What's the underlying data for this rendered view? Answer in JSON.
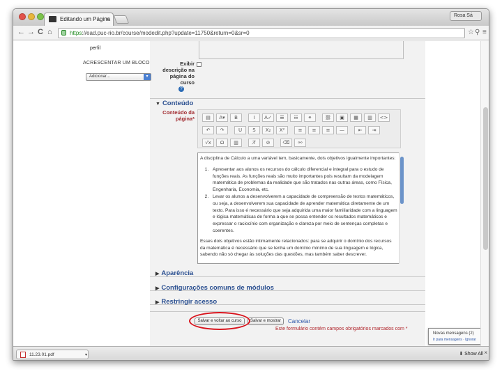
{
  "browser": {
    "tab_title": "Editando um Página",
    "tab_close": "×",
    "user_label": "Rosa Sá",
    "url_scheme": "https",
    "url_rest": "://ead.puc-rio.br/course/modedit.php?update=11750&return=0&sr=0",
    "back": "←",
    "forward": "→",
    "reload": "C",
    "home": "⌂",
    "star": "☆",
    "search": "⚲",
    "menu": "≡"
  },
  "sidebar": {
    "perfil": "perfil",
    "add_block_heading": "ACRESCENTAR UM BLOCO",
    "add_block_select": "Adicionar..."
  },
  "form": {
    "exibir_label": "Exibir descrição na página do curso",
    "help": "?",
    "section_conteudo": "Conteúdo",
    "conteudo_label": "Conteúdo da página*",
    "section_aparencia": "Aparência",
    "section_config": "Configurações comuns de módulos",
    "section_restringir": "Restringir acesso",
    "btn_save_return": "Salvar e voltar ao curso",
    "btn_save_show": "Salvar e mostrar",
    "cancel": "Cancelar",
    "required_note": "Este formulário contém campos obrigatórios marcados com *"
  },
  "editor": {
    "intro": "A disciplina de Cálculo a uma variável tem, basicamente, dois objetivos igualmente importantes:",
    "items": [
      "Apresentar aos alunos os recursos do cálculo diferencial e integral para o estudo de funções reais. As funções reais são muito importantes pois resultam da modelagem matemática de problemas da realidade que são tratados nas outras áreas, como Física, Engenharia, Economia, etc.",
      "Levar os alunos a desenvolverem a capacidade de compreensão de textos matemáticos, ou seja, a desenvolverem sua capacidade de aprender matemática diretamente de um texto. Para isso é necessário que seja adquirida uma maior familiaridade com a linguagem e lógica matemáticas de forma a que se possa entender os resultados matemáticos e expressar o raciocínio com organização e clareza por meio de sentenças completas e coerentes."
    ],
    "outro": "Esses dois objetivos estão intimamente relacionados: para se adquirir o domínio dos recursos da matemática é necessário que se tenha um domínio mínimo de sua linguagem e lógica, sabendo não só chegar às soluções das questões, mas também saber descrever.",
    "toolbar_row1": [
      "▤",
      "A▾",
      "B",
      "I",
      "A✓",
      "☰",
      "☷",
      "⚭",
      "⛓",
      "▣",
      "▦",
      "▥",
      "<>"
    ],
    "toolbar_row2": [
      "↶",
      "↷",
      "U",
      "S",
      "X₂",
      "X²",
      "≡",
      "≡",
      "≡",
      "—",
      "⇤",
      "⇥"
    ],
    "toolbar_row3": [
      "√x",
      "Ω",
      "▥",
      "T̸",
      "⊘",
      "⌫",
      "⚯"
    ]
  },
  "toast": {
    "title": "Novas mensagens (2)",
    "links": "Ir para mensagens · Ignorar"
  },
  "downloads": {
    "file": "11.23.01.pdf",
    "show_all": "Show All"
  },
  "colors": {
    "section_blue": "#2a4f90",
    "required_red": "#a0282d",
    "highlight_circle": "#d8141d"
  }
}
